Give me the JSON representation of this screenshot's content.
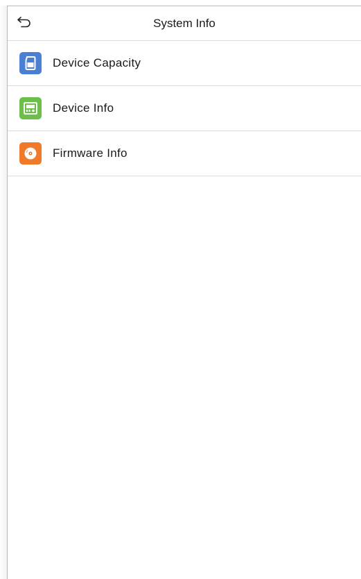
{
  "header": {
    "title": "System Info",
    "back_icon": "back-arrow-icon"
  },
  "menu": {
    "items": [
      {
        "label": "Device Capacity",
        "icon": "sd-card-icon",
        "icon_color": "#4a7fd4"
      },
      {
        "label": "Device Info",
        "icon": "device-info-icon",
        "icon_color": "#6cc04a"
      },
      {
        "label": "Firmware Info",
        "icon": "disc-icon",
        "icon_color": "#f07a2a"
      }
    ]
  },
  "colors": {
    "background": "#ffffff",
    "divider": "#dcdcdc",
    "text": "#1a1a1a"
  }
}
